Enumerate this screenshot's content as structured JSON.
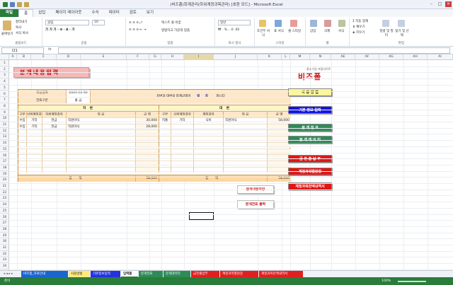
{
  "window": {
    "title": "(비즈폼)회계관리(하위계정과목관리) [호환 모드] - Microsoft Excel"
  },
  "colors": {
    "brand": "#2a7c3a",
    "title_red": "#c01010",
    "header_orange": "#fbd3a0"
  },
  "ribbon": {
    "tabs": [
      "파일",
      "홈",
      "삽입",
      "페이지 레이아웃",
      "수식",
      "데이터",
      "검토",
      "보기"
    ],
    "clipboard": {
      "paste": "붙여넣기",
      "cut": "잘라내기",
      "copy": "복사",
      "format_painter": "서식 복사",
      "label": "클립보드"
    },
    "font": {
      "name": "굴림",
      "size": "10",
      "label": "글꼴"
    },
    "alignment": {
      "wrap": "텍스트 줄 바꿈",
      "merge": "병합하고 가운데 맞춤",
      "label": "맞춤"
    },
    "number": {
      "format": "일반",
      "label": "표시 형식"
    },
    "styles": {
      "cond": "조건부 서식",
      "table": "표 서식",
      "cell": "셀 스타일",
      "label": "스타일"
    },
    "cells": {
      "insert": "삽입",
      "delete": "삭제",
      "format": "서식",
      "label": "셀"
    },
    "editing": {
      "autosum": "자동 합계",
      "fill": "채우기",
      "clear": "지우기",
      "sort": "정렬 및 필터",
      "find": "찾기 및 선택",
      "label": "편집"
    }
  },
  "formula_bar": {
    "name_box": "I21",
    "fx": "fx",
    "content": ""
  },
  "columns": [
    "A",
    "B",
    "C",
    "D",
    "E",
    "F",
    "G",
    "H",
    "I",
    "J",
    "K",
    "L",
    "M",
    "N",
    "AE",
    "AF",
    "AG",
    "AH",
    "AI"
  ],
  "rows": [
    "1",
    "2",
    "3",
    "4",
    "5",
    "6",
    "7",
    "8",
    "9",
    "10",
    "11",
    "12",
    "13",
    "14",
    "15",
    "16",
    "17",
    "18",
    "19",
    "20",
    "21",
    "22",
    "23",
    "24",
    "25",
    "26",
    "27",
    "28",
    "29",
    "30",
    "31",
    "32",
    "33",
    "34"
  ],
  "form": {
    "title": "분개내용입력",
    "logo": {
      "sub": "중소기업 포털사이트",
      "main": "비즈폼"
    },
    "date_label": "작성일자",
    "date_value": "2005-12-30",
    "slip_label": "전표구분",
    "slip_value": "출 금",
    "balance_msg_pre": "차변과 대변의 합계금액이",
    "balance_value": "일 치",
    "balance_msg_post": "합니다",
    "debit_header": "차 변",
    "credit_header": "대 변",
    "col_heads_debit": [
      "구분",
      "상위계정과목",
      "하위계정과목",
      "적 요",
      "금 액"
    ],
    "col_heads_credit": [
      "구분",
      "상위계정과목",
      "계정과목",
      "적 요",
      "금 액"
    ],
    "debit_rows": [
      [
        "수입",
        "기타",
        "현금",
        "직원야식",
        "30,000"
      ],
      [
        "수입",
        "기타",
        "현금",
        "직원야식",
        "28,000"
      ]
    ],
    "credit_rows": [
      [
        "지출",
        "기타",
        "식비",
        "직원야식",
        "58,000"
      ]
    ],
    "total_label": "합 계",
    "debit_total": "58,000",
    "credit_total": "58,000"
  },
  "side_buttons": [
    {
      "label": "사 용 방 법",
      "bg": "#fff69a",
      "fg": "#333"
    },
    {
      "label": "기본 정보 입력",
      "bg": "#1515e0",
      "fg": "#fff"
    },
    {
      "label": "분 개 전 표",
      "bg": "#2e8b57",
      "fg": "#fff"
    },
    {
      "label": "분 개 데 이 터",
      "bg": "#2e8b57",
      "fg": "#fff"
    },
    {
      "label": "금 전 출 납 부",
      "bg": "#e01515",
      "fg": "#fff"
    },
    {
      "label": "계정과목별원장",
      "bg": "#e01515",
      "fg": "#fff"
    },
    {
      "label": "계정과목잔액내역서",
      "bg": "#e01515",
      "fg": "#fff"
    }
  ],
  "actions": {
    "save": "분개내용저장",
    "print": "분개전표 출력"
  },
  "sheet_tabs": [
    {
      "label": "비즈폼_자료안내",
      "color": "#1a66d1"
    },
    {
      "label": "사용방법",
      "color": "#ffe97a"
    },
    {
      "label": "기본정보입력",
      "color": "#2233dd"
    },
    {
      "label": "입력폼",
      "color": "#ffffff"
    },
    {
      "label": "분개전표",
      "color": "#2e8b57"
    },
    {
      "label": "분개데이터",
      "color": "#2e8b57"
    },
    {
      "label": "금전출납부",
      "color": "#e02020"
    },
    {
      "label": "계정과목별원장",
      "color": "#e02020"
    },
    {
      "label": "계정과목잔액내역서",
      "color": "#e02020"
    }
  ],
  "status": {
    "left": "준비",
    "zoom": "100%"
  }
}
